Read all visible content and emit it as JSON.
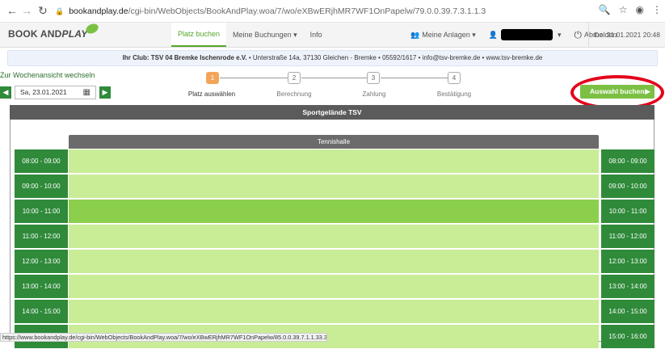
{
  "browser": {
    "url_host": "bookandplay.de",
    "url_path": "/cgi-bin/WebObjects/BookAndPlay.woa/7/wo/eXBwERjhMR7WF1OnPapelw/79.0.0.39.7.3.1.1.3",
    "icons": [
      "back-icon",
      "forward-icon",
      "reload-icon",
      "lock-icon",
      "zoom-icon",
      "star-icon",
      "profile-icon",
      "menu-icon"
    ]
  },
  "header": {
    "logo_book": "BOOK AND",
    "logo_play": "PLAY",
    "nav": {
      "book": "Platz buchen",
      "my_bookings": "Meine Buchungen ▾",
      "info": "Info",
      "facilities": "Meine Anlagen ▾",
      "logout": "Abmelden"
    },
    "datetime": "Do. 21.01.2021 20:48"
  },
  "club_info": {
    "label": "Ihr Club: TSV 04 Bremke Ischenrode e.V.",
    "details": " • Unterstraße 14a, 37130 Gleichen - Bremke • 05592/1617 • info@tsv-bremke.de • www.tsv-bremke.de"
  },
  "week": {
    "label": "Zur Wochenansicht wechseln",
    "date": "Sa, 23.01.2021"
  },
  "steps": [
    {
      "num": "1",
      "label": "Platz auswählen"
    },
    {
      "num": "2",
      "label": "Berechnung"
    },
    {
      "num": "3",
      "label": "Zahlung"
    },
    {
      "num": "4",
      "label": "Bestätigung"
    }
  ],
  "book_button": "Auswahl buchen",
  "grid": {
    "venue": "Sportgelände TSV",
    "hall": "Tennishalle",
    "left_times": [
      "08:00 - 09:00",
      "09:00 - 10:00",
      "10:00 - 11:00",
      "11:00 - 12:00",
      "12:00 - 13:00",
      "13:00 - 14:00",
      "14:00 - 15:00",
      "15:00 - 16:00"
    ],
    "right_times": [
      "08:00 - 09:00",
      "09:00 - 10:00",
      "10:00 - 11:00",
      "11:00 - 12:00",
      "12:00 - 13:00",
      "13:00 - 14:00",
      "14:00 - 15:00",
      "15:00 - 16:00"
    ]
  },
  "statusbar": "https://www.bookandplay.de/cgi-bin/WebObjects/BookAndPlay.woa/7/wo/eXBwERjhMR7WF1OnPapelw/85.0.0.39.7.1.1.33.3",
  "colors": {
    "accent_green": "#7bc043",
    "dark_green": "#2f8a3a",
    "slot_free": "#c9ec96",
    "slot_selected": "#8ccf4d",
    "active_step": "#f2a55a",
    "annotation_red": "#e3001b"
  }
}
